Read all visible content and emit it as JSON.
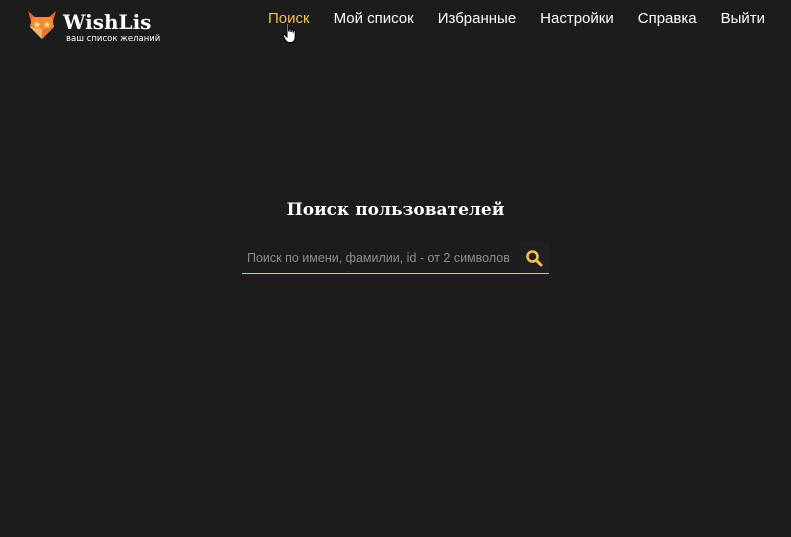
{
  "logo": {
    "title": "WishLis",
    "subtitle": "ваш список желаний"
  },
  "nav": {
    "items": [
      {
        "label": "Поиск",
        "active": true
      },
      {
        "label": "Мой список",
        "active": false
      },
      {
        "label": "Избранные",
        "active": false
      },
      {
        "label": "Настройки",
        "active": false
      },
      {
        "label": "Справка",
        "active": false
      },
      {
        "label": "Выйти",
        "active": false
      }
    ]
  },
  "search": {
    "title": "Поиск пользователей",
    "placeholder": "Поиск по имени, фамилии, id - от 2 символов",
    "value": "",
    "icon": "search-icon"
  },
  "colors": {
    "background": "#1c1c1c",
    "accent": "#f2c14e",
    "text": "#ffffff",
    "placeholder": "#8c8c8c"
  }
}
